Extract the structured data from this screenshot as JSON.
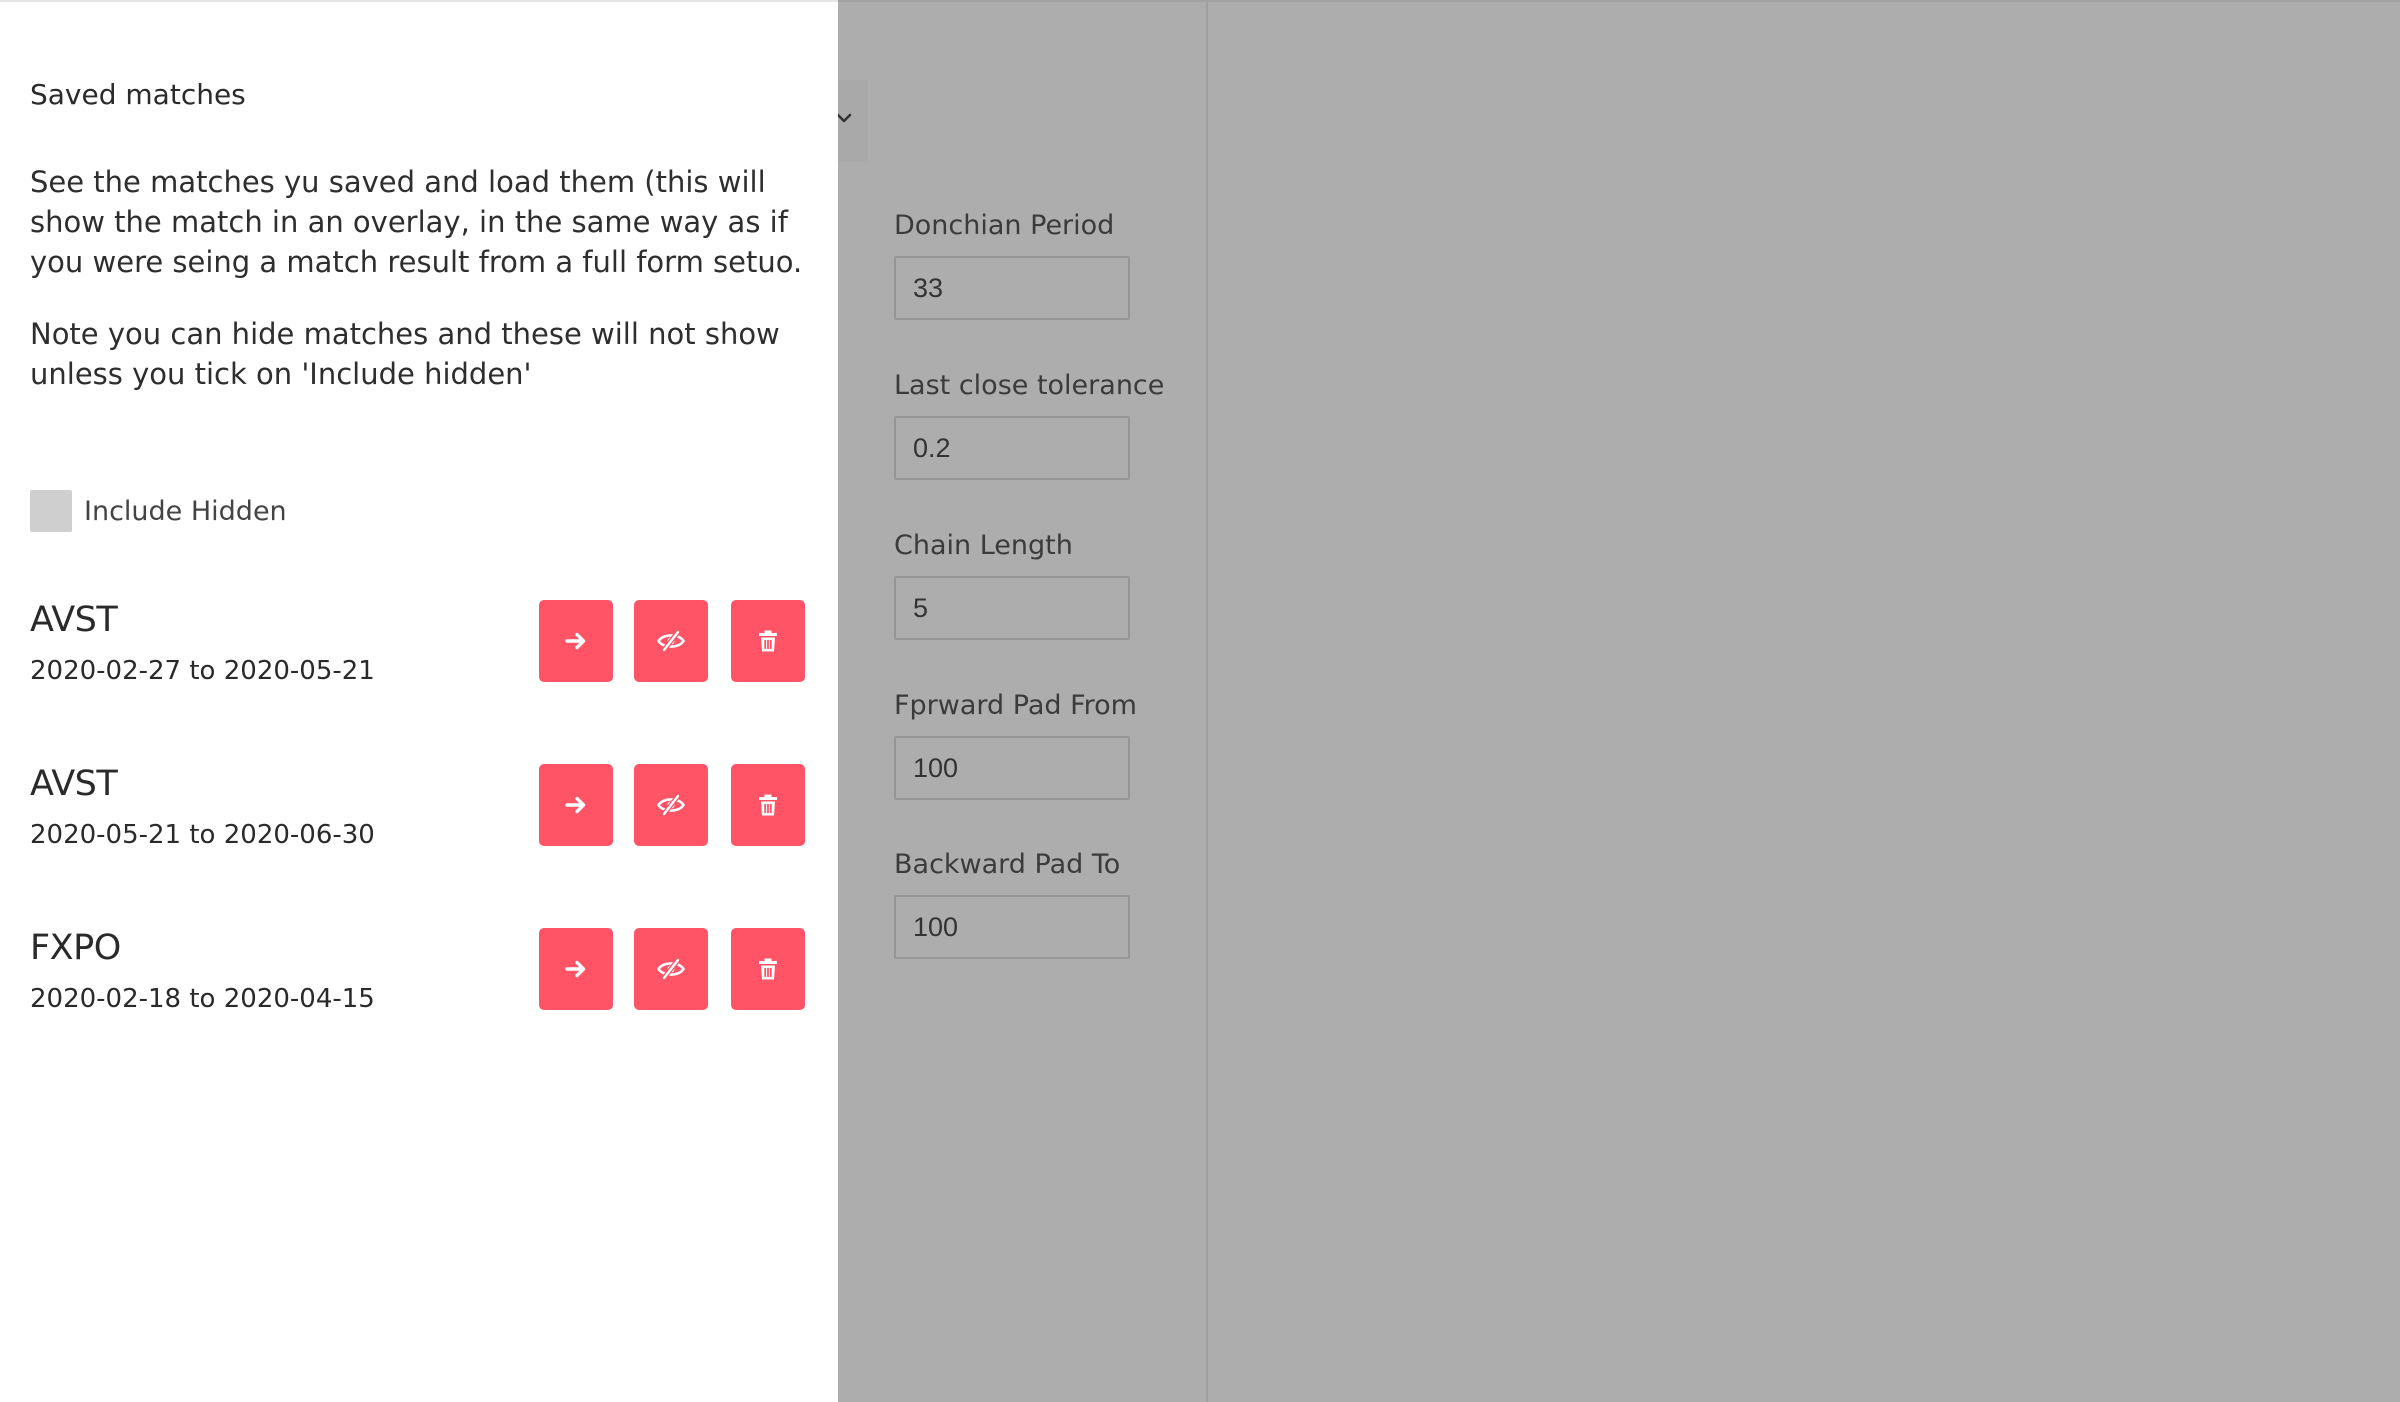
{
  "background_form": {
    "fields": [
      {
        "label": "Donchian Period",
        "value": "33"
      },
      {
        "label": "Last close tolerance",
        "value": "0.2"
      },
      {
        "label": "Chain Length",
        "value": "5"
      },
      {
        "label": "Fprward Pad From",
        "value": "100"
      },
      {
        "label": "Backward Pad To",
        "value": "100"
      }
    ],
    "select_icon": "chevron-down-icon"
  },
  "drawer": {
    "title": "Saved matches",
    "paragraphs": [
      "See the matches yu saved and load them (this will show the match in an overlay, in the same way as if you were seing a match result from a full form setuo.",
      "Note you can hide matches and these will not show unless you tick on 'Include hidden'"
    ],
    "include_hidden": {
      "label": "Include Hidden",
      "checked": false
    },
    "matches": [
      {
        "symbol": "AVST",
        "range": "2020-02-27 to 2020-05-21"
      },
      {
        "symbol": "AVST",
        "range": "2020-05-21 to 2020-06-30"
      },
      {
        "symbol": "FXPO",
        "range": "2020-02-18 to 2020-04-15"
      }
    ],
    "action_icons": [
      "arrow-right-icon",
      "eye-slash-icon",
      "trash-icon"
    ],
    "colors": {
      "accent": "#ff5366",
      "overlay": "#adadad",
      "panel": "#ffffff"
    }
  }
}
